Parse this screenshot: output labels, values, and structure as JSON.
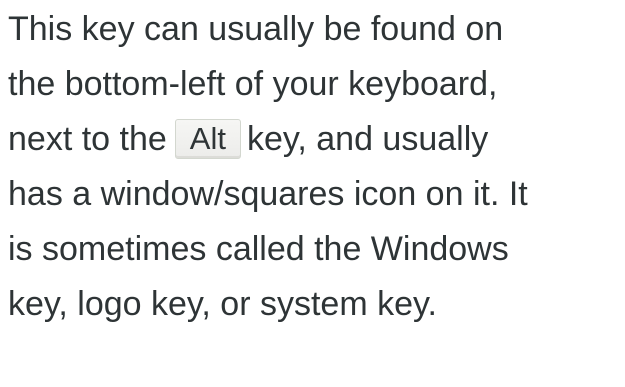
{
  "paragraph": {
    "line1": "This key can usually be found on",
    "line2": "the bottom-left of your keyboard,",
    "line3_before": "next to the",
    "line3_key": "Alt",
    "line3_after": "key, and usually",
    "line4": "has a window/squares icon on it. It",
    "line5": "is sometimes called the Windows",
    "line6": "key, logo key, or system key."
  }
}
